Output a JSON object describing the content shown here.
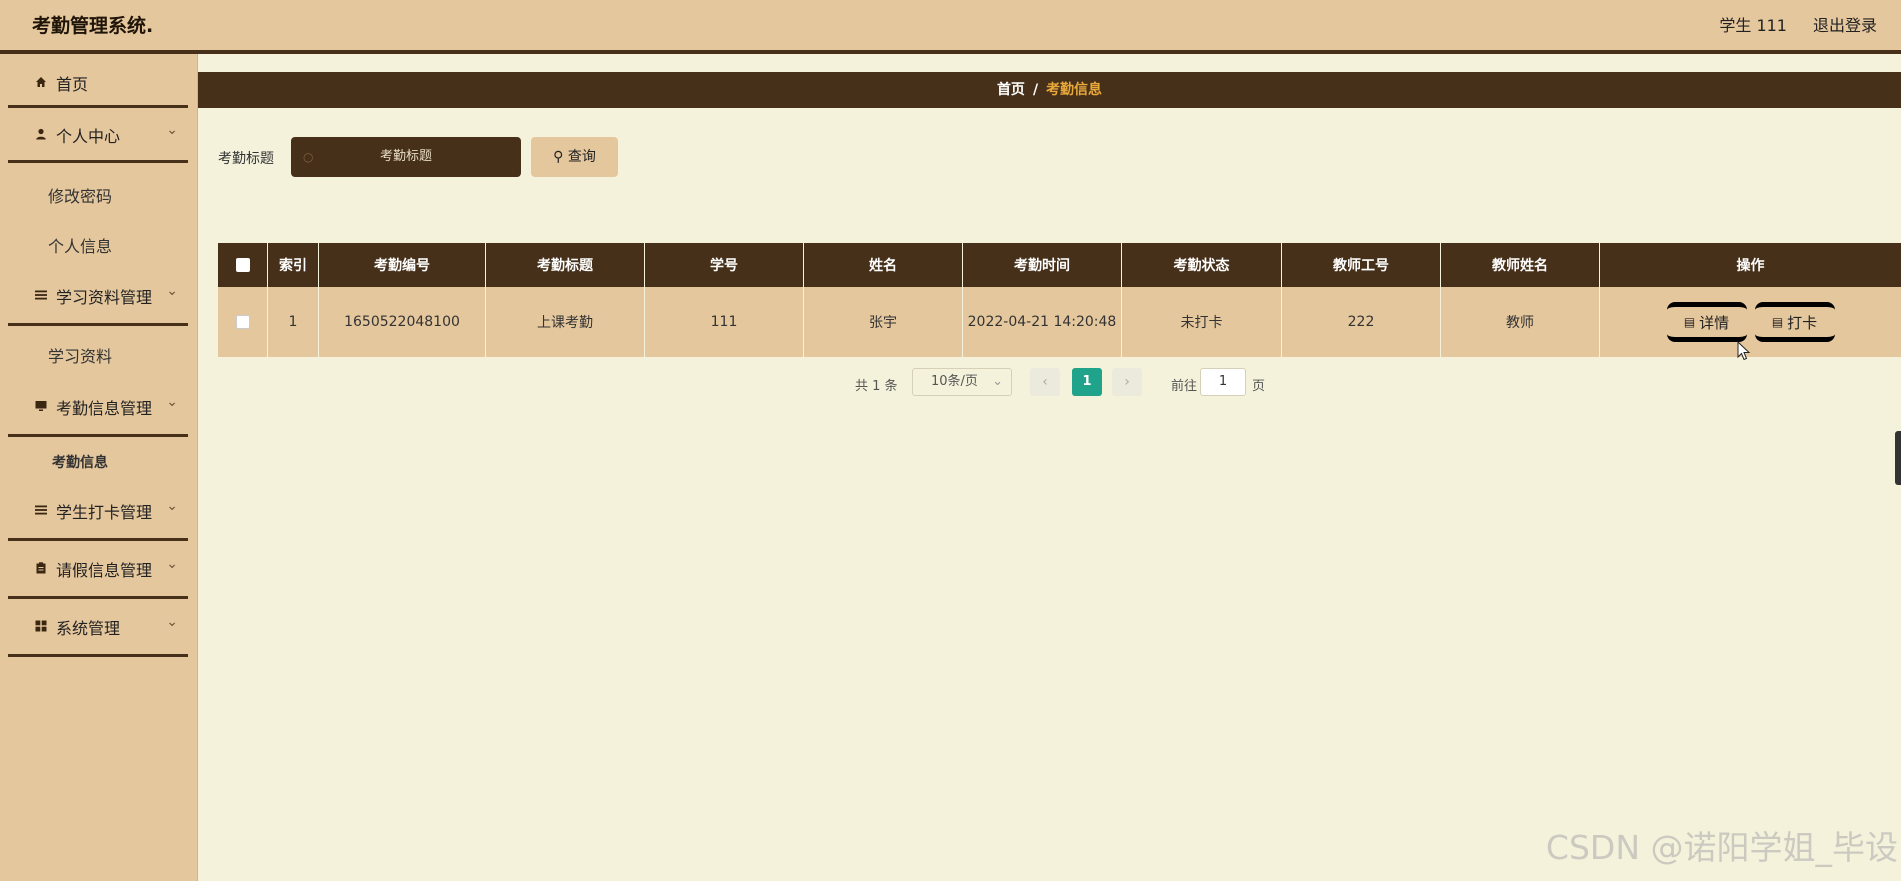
{
  "header": {
    "title": "考勤管理系统.",
    "user": "学生 111",
    "logout": "退出登录"
  },
  "sidebar": {
    "items": [
      {
        "label": "首页",
        "icon": "home-icon"
      },
      {
        "label": "个人中心",
        "icon": "user-icon"
      },
      {
        "label": "修改密码"
      },
      {
        "label": "个人信息"
      },
      {
        "label": "学习资料管理",
        "icon": "list-icon"
      },
      {
        "label": "学习资料"
      },
      {
        "label": "考勤信息管理",
        "icon": "monitor-icon"
      },
      {
        "label": "考勤信息"
      },
      {
        "label": "学生打卡管理",
        "icon": "list-icon"
      },
      {
        "label": "请假信息管理",
        "icon": "clipboard-icon"
      },
      {
        "label": "系统管理",
        "icon": "grid-icon"
      }
    ]
  },
  "breadcrumb": {
    "home": "首页",
    "separator": "/",
    "current": "考勤信息"
  },
  "search": {
    "label": "考勤标题",
    "placeholder": "考勤标题",
    "button": "查询"
  },
  "table": {
    "headers": [
      "索引",
      "考勤编号",
      "考勤标题",
      "学号",
      "姓名",
      "考勤时间",
      "考勤状态",
      "教师工号",
      "教师姓名",
      "操作"
    ],
    "rows": [
      {
        "index": "1",
        "code": "1650522048100",
        "title": "上课考勤",
        "student_id": "111",
        "name": "张宇",
        "time": "2022-04-21 14:20:48",
        "status": "未打卡",
        "teacher_id": "222",
        "teacher_name": "教师",
        "actions": [
          "详情",
          "打卡"
        ]
      }
    ]
  },
  "pagination": {
    "total": "共 1 条",
    "page_size": "10条/页",
    "current_page": "1",
    "goto_label": "前往",
    "goto_value": "1",
    "page_suffix": "页"
  },
  "watermark": "CSDN @诺阳学姐_毕设",
  "colors": {
    "dark_brown": "#47301a",
    "tan": "#e5c79d",
    "cream": "#f5f2dc",
    "accent_orange": "#e9a83a",
    "page_active": "#1fa38a"
  }
}
